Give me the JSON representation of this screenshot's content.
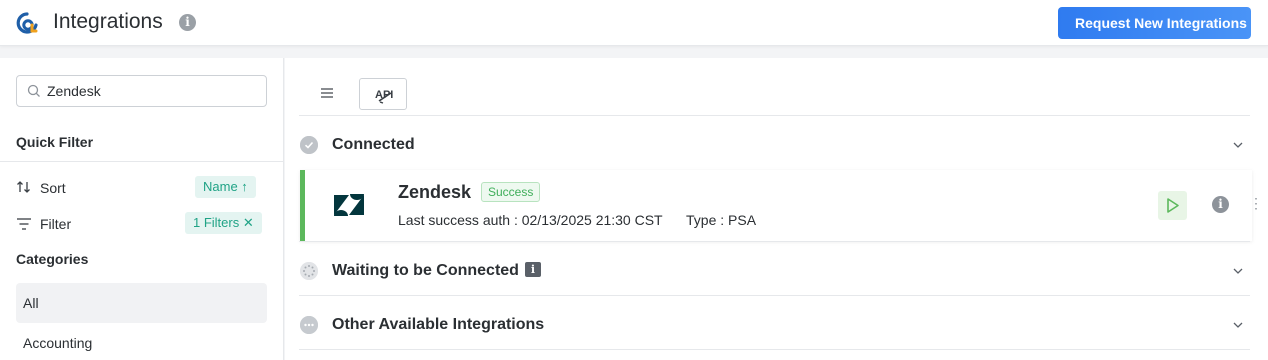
{
  "header": {
    "title": "Integrations",
    "info_icon": "i",
    "request_button": "Request New Integrations",
    "accent_color": "#2f7bf0"
  },
  "sidebar": {
    "search": {
      "value": "Zendesk",
      "icon": "search-icon"
    },
    "quick_filter_title": "Quick Filter",
    "sort": {
      "label": "Sort",
      "chip": "Name ↑",
      "icon": "sort-arrows-icon"
    },
    "filter": {
      "label": "Filter",
      "chip": "1 Filters ✕",
      "icon": "filter-lines-icon"
    },
    "categories_title": "Categories",
    "categories": [
      {
        "label": "All",
        "active": true
      },
      {
        "label": "Accounting",
        "active": false
      }
    ]
  },
  "main": {
    "view_buttons": [
      "list-view-icon",
      "api-view-icon"
    ],
    "api_label": "API",
    "sections": {
      "connected": {
        "title": "Connected",
        "icon": "check-circle-icon"
      },
      "waiting": {
        "title": "Waiting to be Connected",
        "info": "i",
        "icon": "spinner-icon"
      },
      "other": {
        "title": "Other Available Integrations",
        "icon": "more-circle-icon"
      }
    },
    "card": {
      "name": "Zendesk",
      "status": "Success",
      "last_auth": "Last success auth : 02/13/2025 21:30 CST",
      "type": "Type : PSA",
      "info": "i",
      "status_color": "#5cb85c"
    }
  }
}
